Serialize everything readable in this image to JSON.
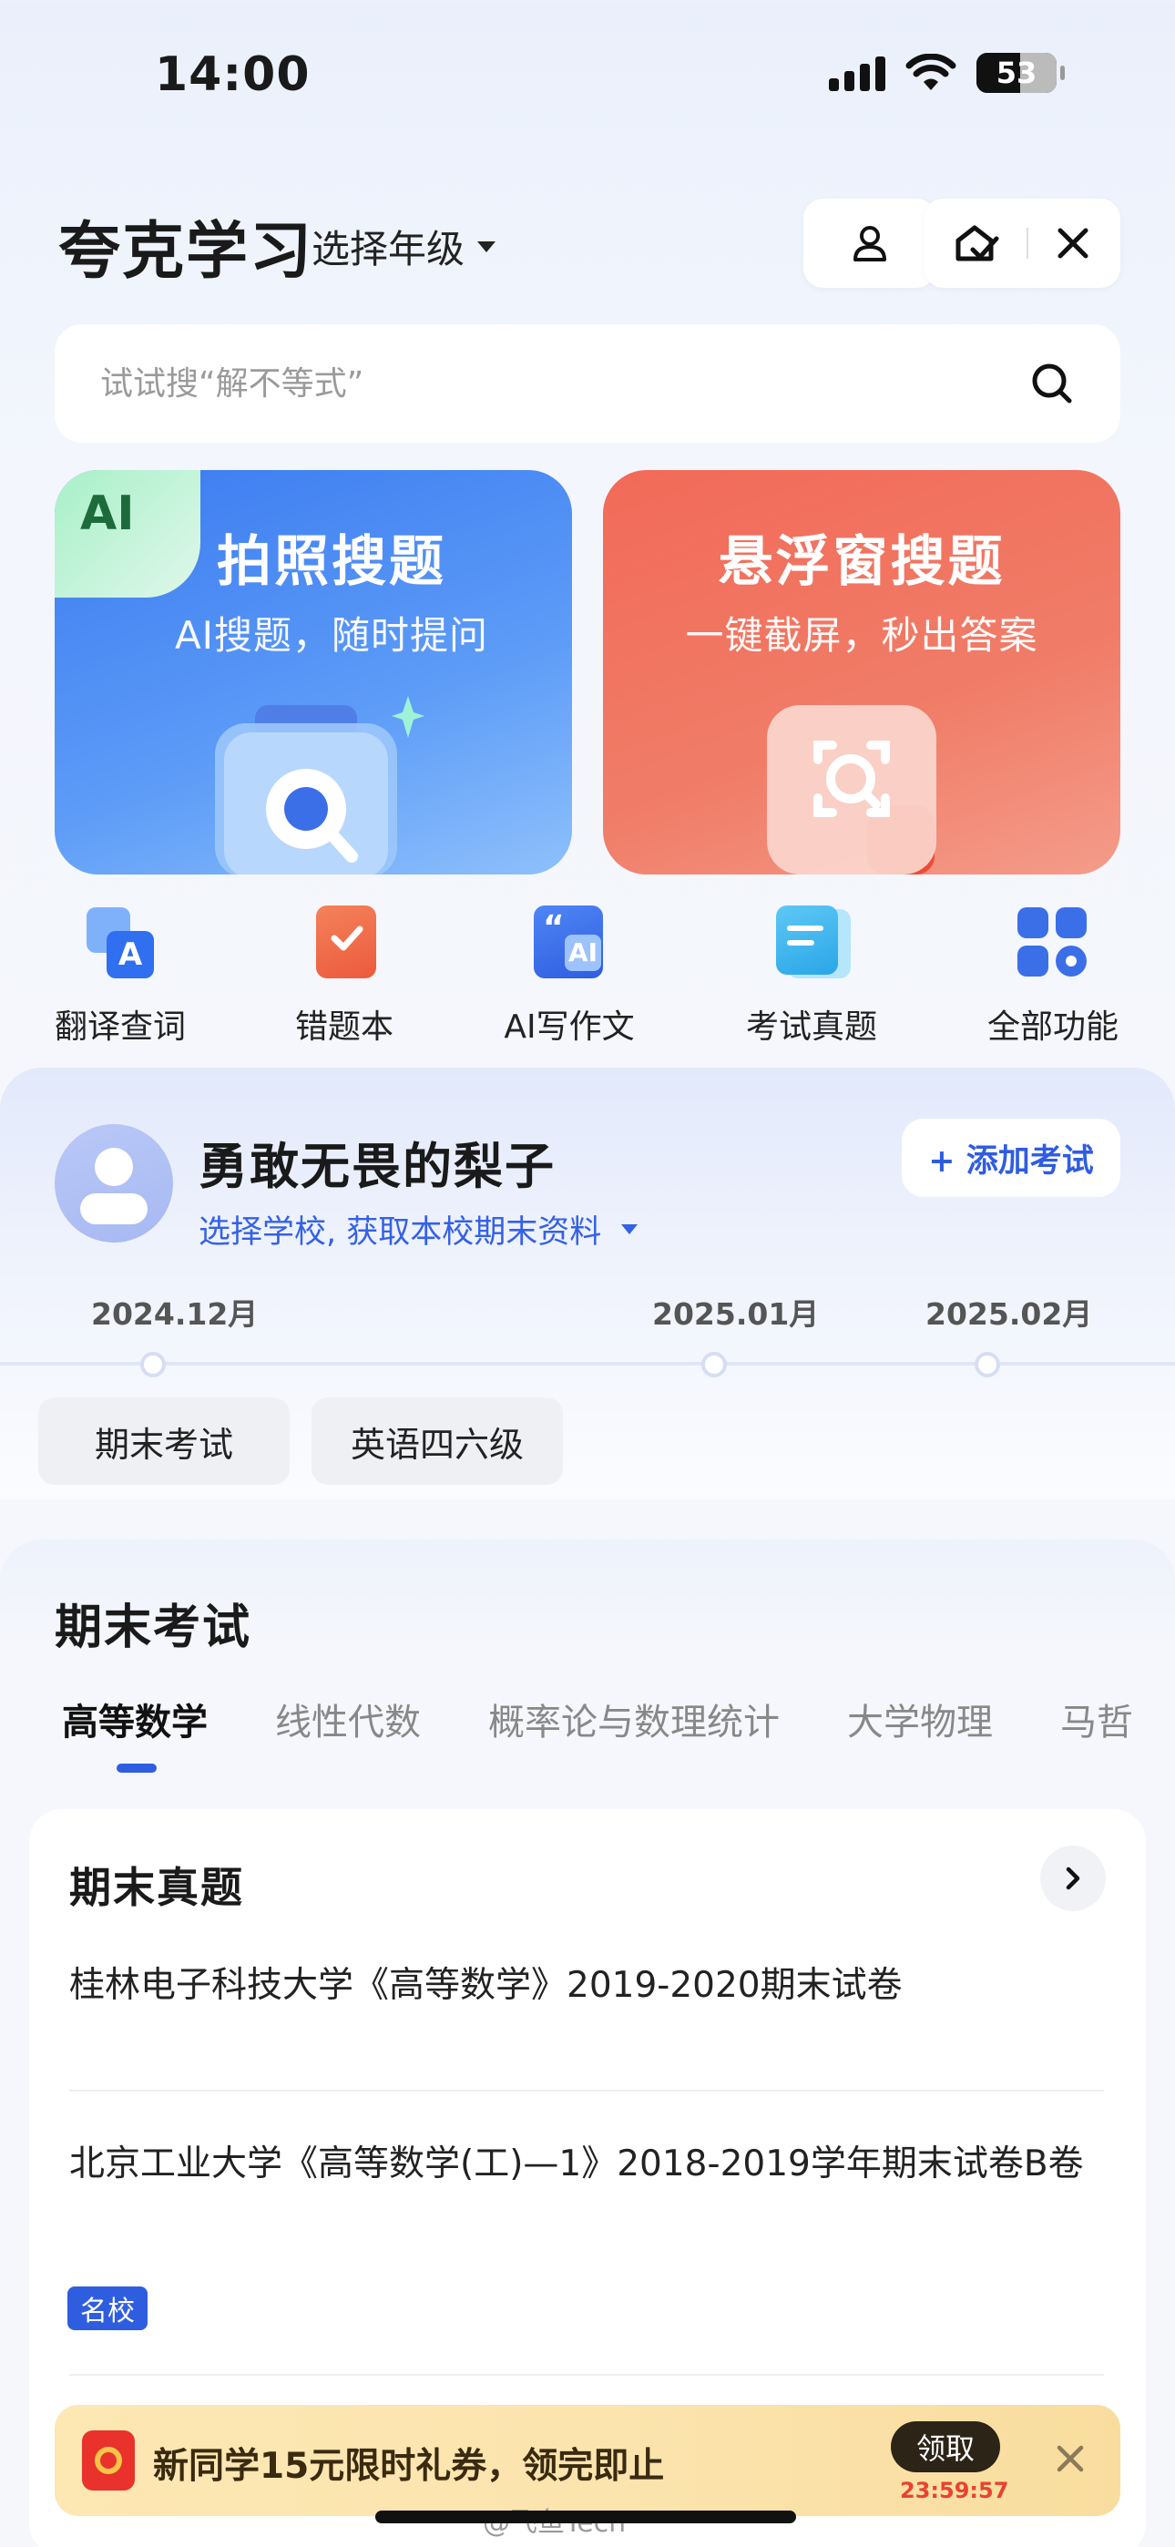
{
  "status_bar": {
    "time": "14:00",
    "battery": "53"
  },
  "header": {
    "app_title": "夸克学习",
    "grade_select": "选择年级"
  },
  "search": {
    "placeholder": "试试搜“解不等式”"
  },
  "feature_cards": [
    {
      "badge": "AI",
      "title": "拍照搜题",
      "subtitle": "AI搜题，随时提问",
      "color": "#3b7bf0"
    },
    {
      "title": "悬浮窗搜题",
      "subtitle": "一键截屏，秒出答案",
      "color": "#f26a58"
    }
  ],
  "tools": [
    {
      "label": "翻译查词",
      "icon": "translate-icon"
    },
    {
      "label": "错题本",
      "icon": "mistake-book-icon"
    },
    {
      "label": "AI写作文",
      "icon": "ai-writing-icon"
    },
    {
      "label": "考试真题",
      "icon": "exam-papers-icon"
    },
    {
      "label": "全部功能",
      "icon": "all-functions-icon"
    }
  ],
  "exam": {
    "username": "勇敢无畏的梨子",
    "school_select": "选择学校, 获取本校期末资料",
    "add_exam": "+ 添加考试",
    "months": [
      "2024.12月",
      "2025.01月",
      "2025.02月"
    ],
    "chips": [
      "期末考试",
      "英语四六级"
    ]
  },
  "final_exam": {
    "title": "期末考试",
    "tabs": [
      "高等数学",
      "线性代数",
      "概率论与数理统计",
      "大学物理",
      "马哲"
    ],
    "active_tab": 0,
    "section_title": "期末真题",
    "papers": [
      {
        "title": "桂林电子科技大学《高等数学》2019-2020期末试卷"
      },
      {
        "title": "北京工业大学《高等数学(工)—1》2018-2019学年期末试卷B卷",
        "tag": "名校"
      }
    ]
  },
  "coupon": {
    "text": "新同学15元限时礼券，领完即止",
    "claim": "领取",
    "countdown": "23:59:57"
  },
  "watermark": "@飞鱼Tech",
  "colors": {
    "accent": "#2f5de0",
    "card_blue": "#3b7bf0",
    "card_red": "#f26a58"
  }
}
